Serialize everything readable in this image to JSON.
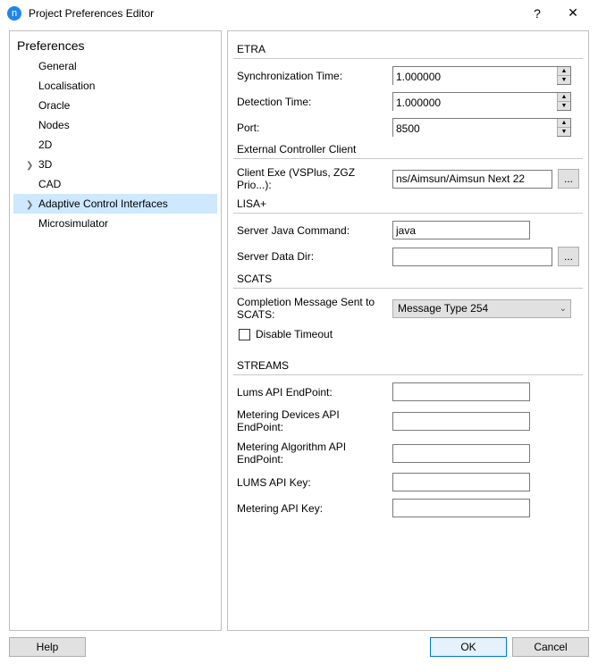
{
  "window": {
    "title": "Project Preferences Editor"
  },
  "sidebar": {
    "title": "Preferences",
    "items": [
      {
        "label": "General",
        "has_children": false
      },
      {
        "label": "Localisation",
        "has_children": false
      },
      {
        "label": "Oracle",
        "has_children": false
      },
      {
        "label": "Nodes",
        "has_children": false
      },
      {
        "label": "2D",
        "has_children": false
      },
      {
        "label": "3D",
        "has_children": true
      },
      {
        "label": "CAD",
        "has_children": false
      },
      {
        "label": "Adaptive Control Interfaces",
        "has_children": true,
        "selected": true
      },
      {
        "label": "Microsimulator",
        "has_children": false
      }
    ]
  },
  "etra": {
    "title": "ETRA",
    "sync_label": "Synchronization Time:",
    "sync_value": "1.000000",
    "detect_label": "Detection Time:",
    "detect_value": "1.000000",
    "port_label": "Port:",
    "port_value": "8500"
  },
  "ext": {
    "title": "External Controller Client",
    "client_label": "Client Exe (VSPlus, ZGZ Prio...):",
    "client_value": "ns/Aimsun/Aimsun Next 22",
    "browse": "..."
  },
  "lisa": {
    "title": "LISA+",
    "java_label": "Server Java Command:",
    "java_value": "java",
    "dir_label": "Server Data Dir:",
    "dir_value": "",
    "browse": "..."
  },
  "scats": {
    "title": "SCATS",
    "completion_label": "Completion Message Sent to SCATS:",
    "completion_value": "Message Type 254",
    "disable_label": "Disable Timeout"
  },
  "streams": {
    "title": "STREAMS",
    "lums_ep_label": "Lums API EndPoint:",
    "lums_ep_value": "",
    "mdev_ep_label": "Metering Devices API EndPoint:",
    "mdev_ep_value": "",
    "malg_ep_label": "Metering Algorithm API EndPoint:",
    "malg_ep_value": "",
    "lums_key_label": "LUMS API Key:",
    "lums_key_value": "",
    "mkey_label": "Metering API Key:",
    "mkey_value": ""
  },
  "footer": {
    "help": "Help",
    "ok": "OK",
    "cancel": "Cancel"
  }
}
